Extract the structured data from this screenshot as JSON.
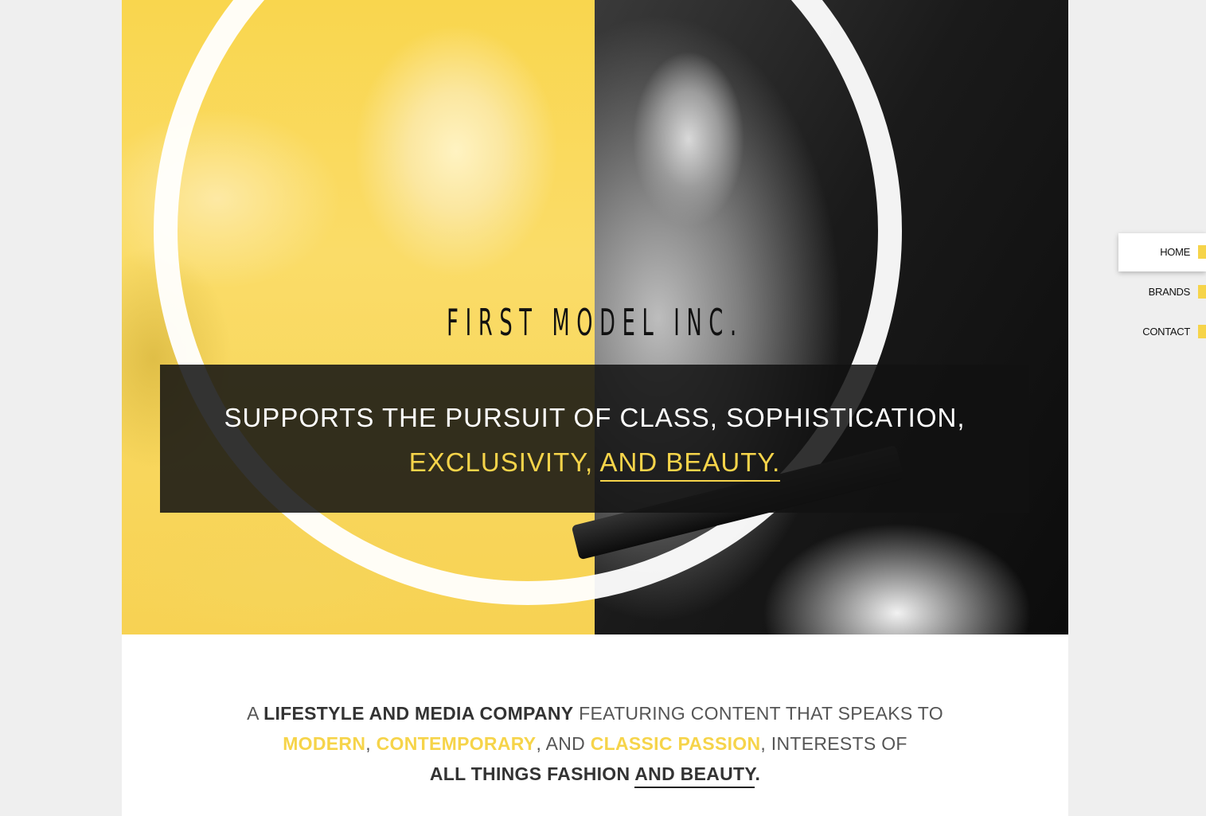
{
  "brand": {
    "title": "FIRST MODEL INC."
  },
  "banner": {
    "line1": "SUPPORTS THE PURSUIT OF CLASS, SOPHISTICATION,",
    "line2_a": "EXCLUSIVITY, ",
    "line2_b": "AND BEAUTY."
  },
  "nav": {
    "items": [
      {
        "label": "HOME",
        "active": true
      },
      {
        "label": "BRANDS",
        "active": false
      },
      {
        "label": "CONTACT",
        "active": false
      }
    ]
  },
  "intro": {
    "a": "A ",
    "lifestyle": "LIFESTYLE AND MEDIA COMPANY",
    "featuring": " FEATURING CONTENT THAT SPEAKS TO",
    "modern": "MODERN",
    "comma1": ", ",
    "contemporary": "CONTEMPORARY",
    "and": ", AND ",
    "classic": "CLASSIC PASSION",
    "interests": ", INTERESTS OF",
    "all_things": "ALL THINGS FASHION ",
    "and_beauty": "AND BEAUTY",
    "period": "."
  },
  "colors": {
    "accent": "#f6d44a",
    "banner_bg": "#121212",
    "page_bg": "#efefef"
  }
}
